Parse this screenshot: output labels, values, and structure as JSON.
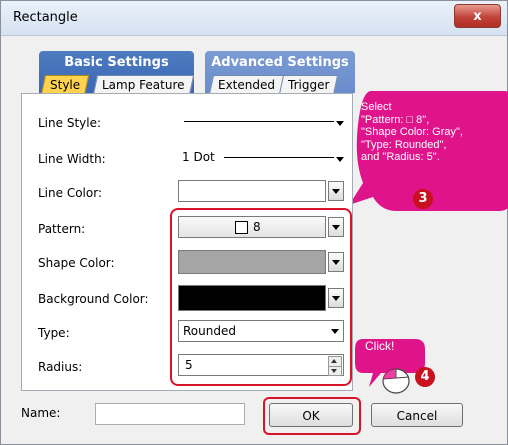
{
  "window": {
    "title": "Rectangle",
    "close_label": "x"
  },
  "tabs": {
    "group1_label": "Basic Settings",
    "group2_label": "Advanced Settings",
    "style": "Style",
    "lamp": "Lamp Feature",
    "extended": "Extended",
    "trigger": "Trigger"
  },
  "form": {
    "line_style_label": "Line Style:",
    "line_width_label": "Line Width:",
    "line_width_value": "1 Dot",
    "line_color_label": "Line Color:",
    "pattern_label": "Pattern:",
    "pattern_value": "8",
    "shape_color_label": "Shape Color:",
    "shape_color_value": "#a6a5a5",
    "bg_color_label": "Background Color:",
    "bg_color_value": "#000000",
    "type_label": "Type:",
    "type_value": "Rounded",
    "radius_label": "Radius:",
    "radius_value": "5"
  },
  "footer": {
    "name_label": "Name:",
    "name_value": "",
    "ok_label": "OK",
    "cancel_label": "Cancel"
  },
  "annotations": {
    "callout_text": "Select\n\"Pattern: □ 8\",\n\"Shape Color: Gray\",\n\"Type: Rounded\",\nand \"Radius: 5\".",
    "step3": "3",
    "click_label": "Click!",
    "step4": "4",
    "accent": "#e0148a"
  }
}
